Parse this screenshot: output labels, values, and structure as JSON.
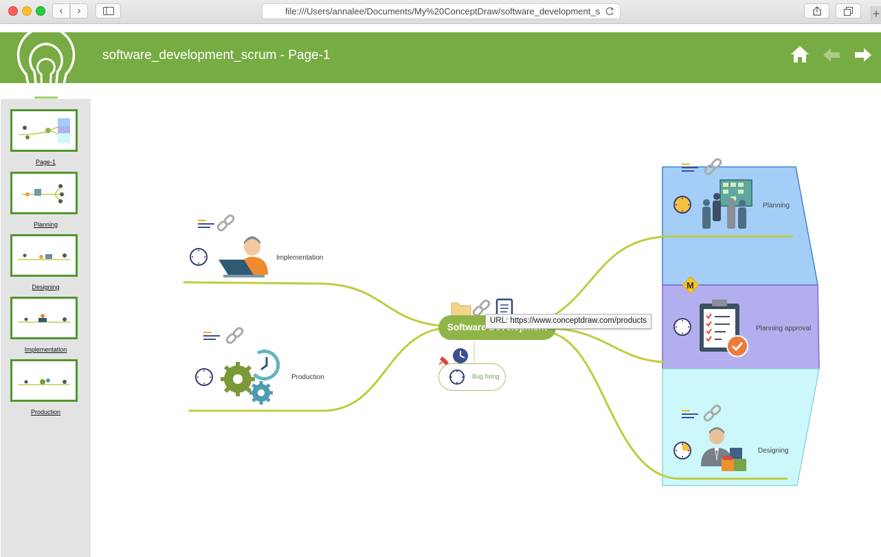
{
  "browser": {
    "url": "file:///Users/annalee/Documents/My%20ConceptDraw/software_development_s",
    "back_icon": "‹",
    "forward_icon": "›",
    "new_tab_icon": "+"
  },
  "header": {
    "title": "software_development_scrum - Page-1",
    "accent_color": "#77ab43"
  },
  "sidebar": {
    "pages": [
      {
        "label": "Page-1"
      },
      {
        "label": "Planning"
      },
      {
        "label": "Designing"
      },
      {
        "label": "Implementation"
      },
      {
        "label": "Production"
      }
    ]
  },
  "mindmap": {
    "central": "Software Development",
    "tooltip": "URL: https://www.conceptdraw.com/products",
    "bug_fixing": "Bug fixing",
    "implementation": "Implementation",
    "production": "Production",
    "planning": "Planning",
    "planning_approval": "Planning approval",
    "designing": "Designing",
    "milestone_badge": "M",
    "colors": {
      "branch": "#bfcc3c",
      "planning_band": "#a4cef8",
      "approval_band": "#b3afef",
      "designing_band": "#ccf8fb"
    }
  }
}
